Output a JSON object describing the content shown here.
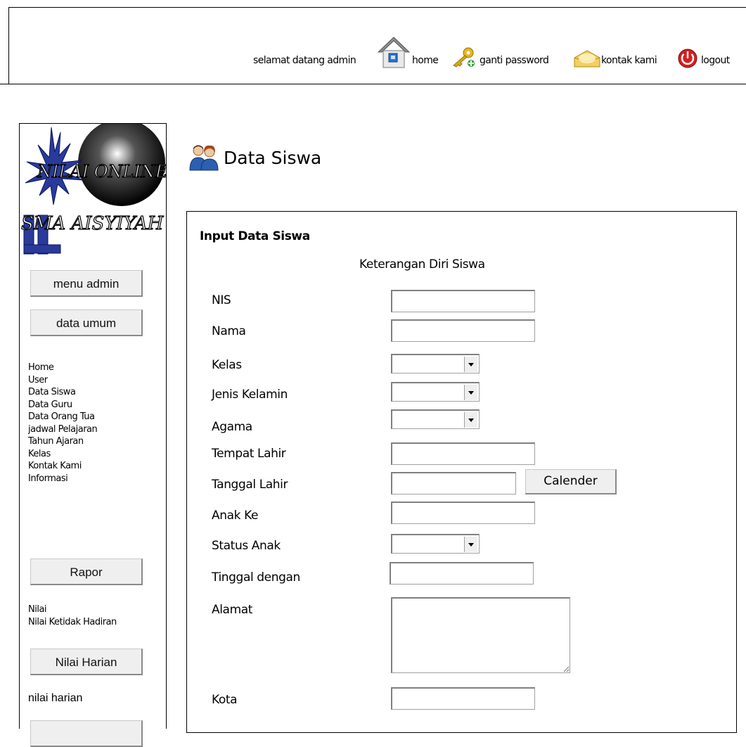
{
  "header": {
    "greeting": "selamat datang admin",
    "nav": [
      {
        "label": "home",
        "icon": "home-icon"
      },
      {
        "label": "ganti password",
        "icon": "key-icon"
      },
      {
        "label": "kontak kami",
        "icon": "envelope-icon"
      },
      {
        "label": "logout",
        "icon": "power-icon"
      }
    ]
  },
  "sidebar": {
    "logo": {
      "line1": "NILAI ONLINE",
      "line2": "SMA AISYIYAH"
    },
    "buttons": {
      "menu_admin": "menu admin",
      "data_umum": "data umum",
      "rapor": "Rapor",
      "nilai_harian": "Nilai Harian"
    },
    "data_umum_items": [
      "Home",
      "User",
      "Data Siswa",
      "Data Guru",
      "Data Orang Tua",
      "jadwal Pelajaran",
      "Tahun Ajaran",
      "Kelas",
      "Kontak Kami",
      "Informasi"
    ],
    "rapor_items": [
      "Nilai",
      "Nilai Ketidak Hadiran"
    ],
    "nilai_harian_items": [
      "nilai harian"
    ]
  },
  "page": {
    "title": "Data Siswa",
    "panel_heading": "Input Data Siswa",
    "panel_subheading": "Keterangan Diri Siswa",
    "fields": {
      "nis": "NIS",
      "nama": "Nama",
      "kelas": "Kelas",
      "jenis_kelamin": "Jenis Kelamin",
      "agama": "Agama",
      "tempat_lahir": "Tempat Lahir",
      "tanggal_lahir": "Tanggal Lahir",
      "anak_ke": "Anak Ke",
      "status_anak": "Status Anak",
      "tinggal_dengan": "Tinggal dengan",
      "alamat": "Alamat",
      "kota": "Kota"
    },
    "calendar_button": "Calender"
  }
}
